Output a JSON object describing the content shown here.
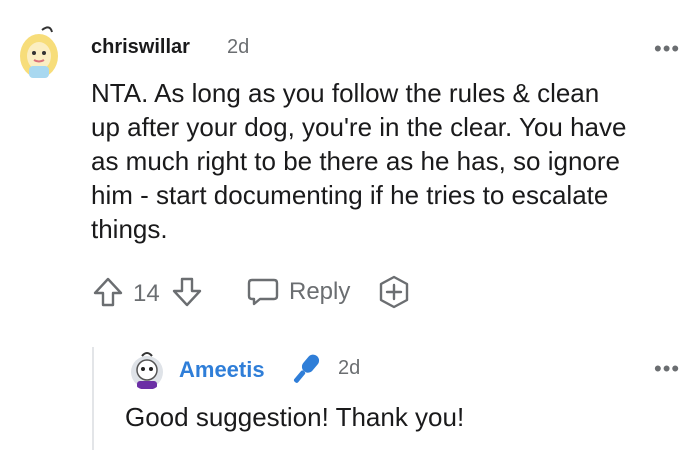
{
  "comment": {
    "author": "chriswillar",
    "time": "2d",
    "text": "NTA. As long as you follow the rules & clean up after your dog, you're in the clear. You have as much right to be there as he has, so ignore him - start documenting if he tries to escalate things.",
    "lines": [
      "NTA. As long as you follow the rules & clean",
      "up after your dog, you're in the clear. You have",
      "as much right to be there as he has, so ignore",
      "him - start documenting if he tries to escalate",
      "things."
    ],
    "score": "14",
    "reply_label": "Reply",
    "more_label": "•••"
  },
  "reply": {
    "author": "Ameetis",
    "time": "2d",
    "text": "Good suggestion! Thank you!",
    "more_label": "•••"
  },
  "colors": {
    "accent_blue": "#2f7ed8",
    "muted": "#6b6e71",
    "text": "#1a1a1b"
  },
  "icons": [
    "avatar-chriswillar",
    "more-icon",
    "upvote-icon",
    "downvote-icon",
    "reply-icon",
    "award-icon",
    "avatar-ameetis",
    "microphone-icon"
  ]
}
